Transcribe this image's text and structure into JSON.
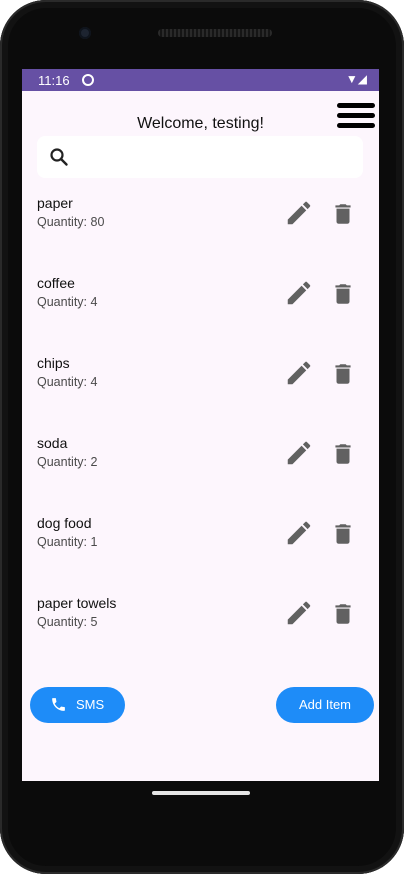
{
  "status_bar": {
    "time": "11:16",
    "icons": "▼◢"
  },
  "header": {
    "welcome": "Welcome, testing!",
    "menu_icon": "hamburger-menu-icon"
  },
  "search": {
    "icon": "search-icon",
    "placeholder": ""
  },
  "items": [
    {
      "name": "paper",
      "quantity": "Quantity: 80"
    },
    {
      "name": "coffee",
      "quantity": "Quantity: 4"
    },
    {
      "name": "chips",
      "quantity": "Quantity: 4"
    },
    {
      "name": "soda",
      "quantity": "Quantity: 2"
    },
    {
      "name": "dog food",
      "quantity": "Quantity: 1"
    },
    {
      "name": "paper towels",
      "quantity": "Quantity: 5"
    }
  ],
  "actions": {
    "sms_label": "SMS",
    "add_label": "Add Item"
  },
  "colors": {
    "status_bar": "#6650a4",
    "background": "#fdf6fd",
    "accent": "#1e8cf8",
    "icon_gray": "#616161"
  }
}
